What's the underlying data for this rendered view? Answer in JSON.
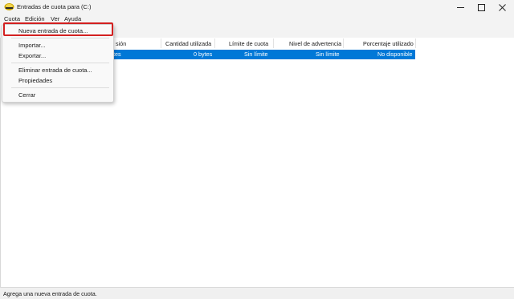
{
  "window": {
    "title": "Entradas de cuota para  (C:)"
  },
  "menubar": {
    "cuota": "Cuota",
    "edicion": "Edición",
    "ver": "Ver",
    "ayuda": "Ayuda"
  },
  "dropdown": {
    "items": {
      "nueva": "Nueva entrada de cuota...",
      "importar": "Importar...",
      "exportar": "Exportar...",
      "eliminar": "Eliminar entrada de cuota...",
      "propiedades": "Propiedades",
      "cerrar": "Cerrar"
    }
  },
  "table": {
    "columns": {
      "nombre_partial": "sión",
      "cantidad": "Cantidad utilizada",
      "limite": "Límite de cuota",
      "nivel": "Nivel de advertencia",
      "porcentaje": "Porcentaje utilizado"
    },
    "row": {
      "nombre_partial": "tes",
      "cantidad": "0 bytes",
      "limite": "Sin límite",
      "nivel": "Sin límite",
      "porcentaje": "No disponible"
    }
  },
  "status": {
    "text": "Agrega una nueva entrada de cuota."
  },
  "colors": {
    "selection": "#0078d7",
    "highlight": "#d32020"
  }
}
